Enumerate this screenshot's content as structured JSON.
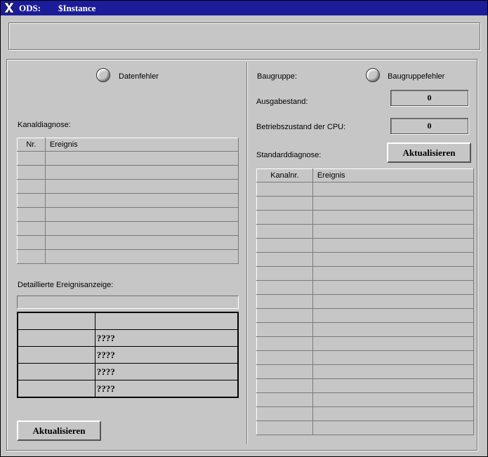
{
  "window": {
    "app": "ODS:",
    "instance": "$Instance"
  },
  "left": {
    "datenfehler_label": "Datenfehler",
    "kanaldiagnose_label": "Kanaldiagnose:",
    "kanal_table": {
      "headers": [
        "Nr.",
        "Ereignis"
      ],
      "row_count": 8
    },
    "detail_label": "Detaillierte Ereignisanzeige:",
    "detail_rows": [
      "",
      "????",
      "????",
      "????",
      "????"
    ],
    "button_label": "Aktualisieren"
  },
  "right": {
    "baugruppe_label": "Baugruppe:",
    "baugruppefehler_label": "Baugruppefehler",
    "ausgabestand_label": "Ausgabestand:",
    "ausgabestand_value": "0",
    "betriebszustand_label": "Betriebszustand der CPU:",
    "betriebszustand_value": "0",
    "standarddiagnose_label": "Standarddiagnose:",
    "button_label": "Aktualisieren",
    "std_table": {
      "headers": [
        "Kanalnr.",
        "Ereignis"
      ],
      "row_count": 18
    }
  }
}
